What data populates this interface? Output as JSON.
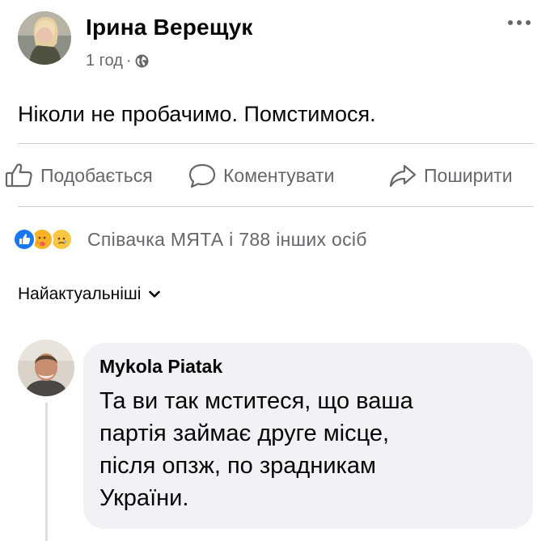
{
  "post": {
    "author": "Ірина Верещук",
    "time": "1 год",
    "separator": "·",
    "audience_icon": "globe-icon",
    "more_icon": "more-horizontal-icon",
    "text": "Ніколи не пробачимо. Помстимося."
  },
  "actions": {
    "like": {
      "label": "Подобається",
      "icon": "thumbs-up-icon"
    },
    "comment": {
      "label": "Коментувати",
      "icon": "comment-icon"
    },
    "share": {
      "label": "Поширити",
      "icon": "share-icon"
    }
  },
  "reactions": {
    "icons": [
      "like-reaction-icon",
      "care-reaction-icon",
      "sad-reaction-icon"
    ],
    "summary": "Співачка МЯТА і 788 інших осіб"
  },
  "comments_sort": {
    "label": "Найактуальніші",
    "icon": "chevron-down-icon"
  },
  "comments": [
    {
      "author": "Mykola Piatak",
      "lines": [
        "Та ви так мститеся, що ваша",
        "партія займає друге місце,",
        "після опзж, по зрадникам",
        "України."
      ]
    }
  ],
  "colors": {
    "text_primary": "#050505",
    "text_secondary": "#65676b",
    "divider": "#ced0d4",
    "comment_bubble": "#f0f2f5",
    "like_blue": "#1877f2"
  }
}
